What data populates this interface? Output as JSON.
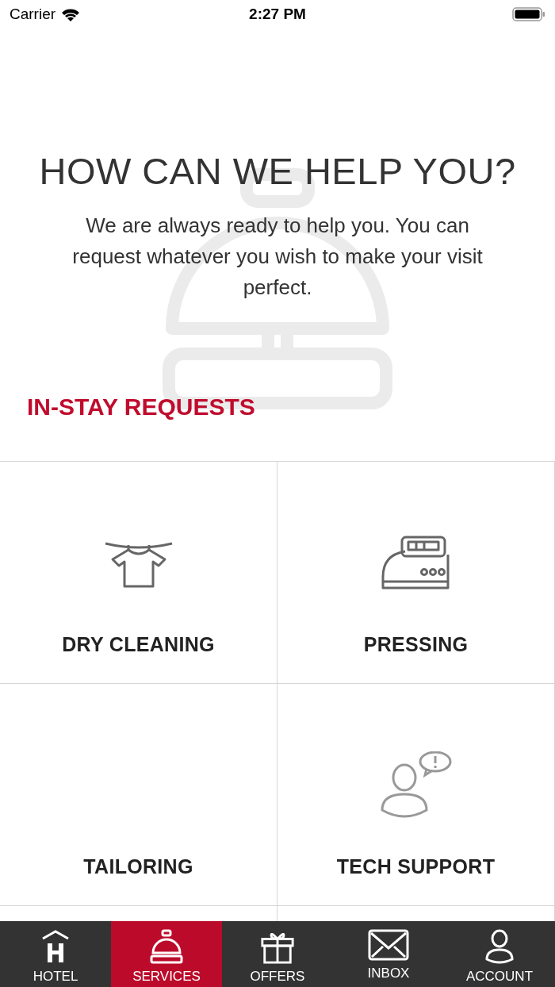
{
  "status_bar": {
    "carrier": "Carrier",
    "time": "2:27 PM"
  },
  "hero": {
    "title": "HOW CAN WE HELP YOU?",
    "text": "We are always ready to help you. You can request whatever you wish to make your visit perfect."
  },
  "section": {
    "title": "IN-STAY REQUESTS"
  },
  "services": [
    {
      "label": "DRY CLEANING",
      "kind": "shirt"
    },
    {
      "label": "PRESSING",
      "kind": "iron"
    },
    {
      "label": "TAILORING",
      "kind": "blank"
    },
    {
      "label": "TECH SUPPORT",
      "kind": "support"
    }
  ],
  "tabs": [
    {
      "label": "HOTEL",
      "kind": "hotel",
      "selected": false
    },
    {
      "label": "SERVICES",
      "kind": "bell",
      "selected": true
    },
    {
      "label": "OFFERS",
      "kind": "gift",
      "selected": false
    },
    {
      "label": "INBOX",
      "kind": "mail",
      "selected": false
    },
    {
      "label": "ACCOUNT",
      "kind": "person",
      "selected": false
    }
  ]
}
